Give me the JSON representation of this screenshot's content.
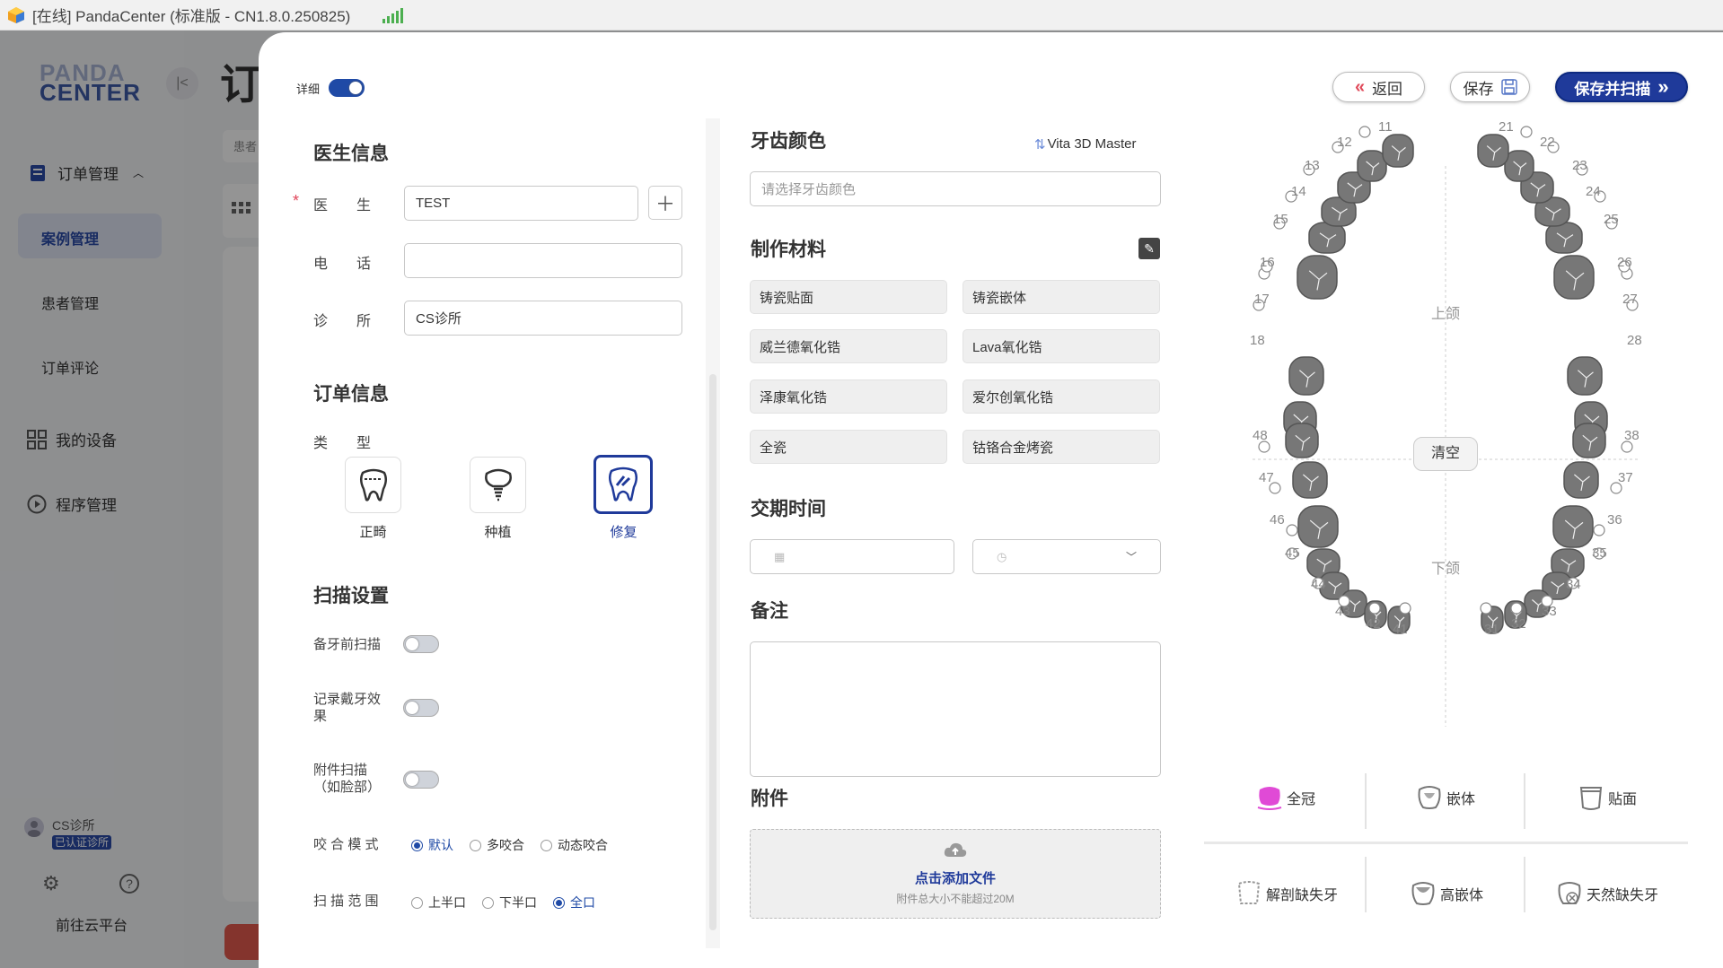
{
  "window": {
    "title": "[在线] PandaCenter (标准版 - CN1.8.0.250825)"
  },
  "sidebar": {
    "logo_line1": "PANDA",
    "logo_line2": "CENTER",
    "items": [
      {
        "label": "订单管理",
        "icon": "order-icon"
      },
      {
        "label": "案例管理"
      },
      {
        "label": "患者管理"
      },
      {
        "label": "订单评论"
      },
      {
        "label": "我的设备",
        "icon": "grid-icon"
      },
      {
        "label": "程序管理",
        "icon": "play-icon"
      }
    ],
    "clinic_name": "CS诊所",
    "clinic_badge": "已认证诊所",
    "cloud_link": "前往云平台"
  },
  "background": {
    "page_title_char": "订",
    "patient_label": "患者"
  },
  "modal": {
    "detail_label": "详细",
    "doctor_section": {
      "title": "医生信息",
      "doctor_label": "医　　生",
      "doctor_value": "TEST",
      "phone_label": "电　　话",
      "phone_value": "",
      "clinic_label": "诊　　所",
      "clinic_value": "CS诊所"
    },
    "order_section": {
      "title": "订单信息",
      "type_label": "类　　型",
      "types": [
        {
          "label": "正畸",
          "icon": "orthodontic-tooth-icon",
          "selected": false
        },
        {
          "label": "种植",
          "icon": "implant-tooth-icon",
          "selected": false
        },
        {
          "label": "修复",
          "icon": "restoration-tooth-icon",
          "selected": true
        }
      ]
    },
    "scan_section": {
      "title": "扫描设置",
      "pre_scan": "备牙前扫描",
      "record_wear_line1": "记录戴牙效",
      "record_wear_line2": "果",
      "attach_scan_line1": "附件扫描",
      "attach_scan_line2": "（如脸部）",
      "bite_label": "咬 合 模 式",
      "bite_options": [
        "默认",
        "多咬合",
        "动态咬合"
      ],
      "bite_selected": "默认",
      "range_label": "扫 描 范 围",
      "range_options": [
        "上半口",
        "下半口",
        "全口"
      ],
      "range_selected": "全口"
    },
    "shade": {
      "title": "牙齿颜色",
      "system": "Vita 3D Master",
      "placeholder": "请选择牙齿颜色"
    },
    "material": {
      "title": "制作材料",
      "items": [
        "铸瓷贴面",
        "铸瓷嵌体",
        "威兰德氧化锆",
        "Lava氧化锆",
        "泽康氧化锆",
        "爱尔创氧化锆",
        "全瓷",
        "钴铬合金烤瓷"
      ]
    },
    "delivery": {
      "title": "交期时间"
    },
    "notes": {
      "title": "备注"
    },
    "attachment": {
      "title": "附件",
      "upload_label": "点击添加文件",
      "upload_hint": "附件总大小不能超过20M"
    },
    "buttons": {
      "back": "返回",
      "save": "保存",
      "save_scan": "保存并扫描"
    },
    "chart": {
      "upper_label": "上颌",
      "lower_label": "下颌",
      "clear_label": "清空",
      "upper_numbers": [
        "18",
        "17",
        "16",
        "15",
        "14",
        "13",
        "12",
        "11",
        "21",
        "22",
        "23",
        "24",
        "25",
        "26",
        "27",
        "28"
      ],
      "lower_numbers": [
        "48",
        "47",
        "46",
        "45",
        "44",
        "43",
        "42",
        "41",
        "31",
        "32",
        "33",
        "34",
        "35",
        "36",
        "37",
        "38"
      ]
    },
    "restoration_types": [
      {
        "label": "全冠",
        "icon": "crown-icon"
      },
      {
        "label": "嵌体",
        "icon": "inlay-icon"
      },
      {
        "label": "贴面",
        "icon": "veneer-icon"
      },
      {
        "label": "解剖缺失牙",
        "icon": "anatomic-missing-icon"
      },
      {
        "label": "高嵌体",
        "icon": "onlay-icon"
      },
      {
        "label": "天然缺失牙",
        "icon": "natural-missing-icon"
      }
    ],
    "colors": {
      "primary": "#1f3a9a",
      "required": "#e0455a",
      "crown": "#e04ad6"
    }
  }
}
